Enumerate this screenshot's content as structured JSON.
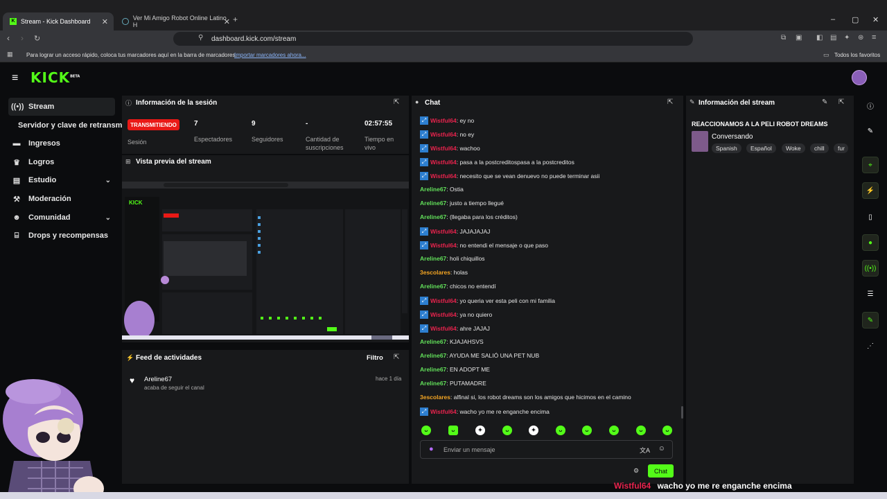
{
  "browser": {
    "tabs": [
      {
        "label": "Stream - Kick Dashboard",
        "active": true
      },
      {
        "label": "Ver Mi Amigo Robot Online Latino H",
        "active": false
      }
    ],
    "url": "dashboard.kick.com/stream",
    "bookmarks_hint": "Para lograr un acceso rápido, coloca tus marcadores aquí en la barra de marcadores.",
    "bookmarks_link": "Importar marcadores ahora...",
    "all_bookmarks": "Todos los favoritos"
  },
  "kick": {
    "logo": "KICK",
    "logo_beta": "BETA"
  },
  "sidebar": {
    "items": [
      {
        "label": "Stream",
        "icon": "broadcast-icon"
      },
      {
        "label": "Servidor y clave de retransmisión",
        "icon": ""
      },
      {
        "label": "Ingresos",
        "icon": "money-icon"
      },
      {
        "label": "Logros",
        "icon": "trophy-icon"
      },
      {
        "label": "Estudio",
        "icon": "studio-icon"
      },
      {
        "label": "Moderación",
        "icon": "hammer-icon"
      },
      {
        "label": "Comunidad",
        "icon": "community-icon"
      },
      {
        "label": "Drops y recompensas",
        "icon": "gift-icon"
      }
    ]
  },
  "session": {
    "title": "Información de la sesión",
    "live_badge": "TRANSMITIENDO",
    "live_label": "Sesión",
    "viewers": "7",
    "viewers_label": "Espectadores",
    "followers": "9",
    "followers_label": "Seguidores",
    "subs": "-",
    "subs_label": "Cantidad de suscripciones",
    "uptime": "02:57:55",
    "uptime_label": "Tiempo en vivo"
  },
  "preview": {
    "title": "Vista previa del stream"
  },
  "activity": {
    "title": "Feed de actividades",
    "filter": "Filtro",
    "items": [
      {
        "user": "Areline67",
        "action": "acaba de seguir el canal",
        "time": "hace 1 día"
      }
    ]
  },
  "chat": {
    "title": "Chat",
    "messages": [
      {
        "user": "Wistful64",
        "color": "red",
        "badge": true,
        "text": ": ey no"
      },
      {
        "user": "Wistful64",
        "color": "red",
        "badge": true,
        "text": ": no ey"
      },
      {
        "user": "Wistful64",
        "color": "red",
        "badge": true,
        "text": ": wachoo"
      },
      {
        "user": "Wistful64",
        "color": "red",
        "badge": true,
        "text": ": pasa a la postcreditospasa a la postcreditos"
      },
      {
        "user": "Wistful64",
        "color": "red",
        "badge": true,
        "text": ": necesito que se vean denuevo no puede terminar asii"
      },
      {
        "user": "Areline67",
        "color": "green",
        "badge": false,
        "text": ": Ostia"
      },
      {
        "user": "Areline67",
        "color": "green",
        "badge": false,
        "text": ": justo a tiempo llegué"
      },
      {
        "user": "Areline67",
        "color": "green",
        "badge": false,
        "text": ": (llegaba para los créditos)"
      },
      {
        "user": "Wistful64",
        "color": "red",
        "badge": true,
        "text": ": JAJAJAJAJ"
      },
      {
        "user": "Wistful64",
        "color": "red",
        "badge": true,
        "text": ": no entendi el mensaje o que paso"
      },
      {
        "user": "Areline67",
        "color": "green",
        "badge": false,
        "text": ": holi chiquillos"
      },
      {
        "user": "3escolares",
        "color": "orange",
        "badge": false,
        "text": ": holas"
      },
      {
        "user": "Areline67",
        "color": "green",
        "badge": false,
        "text": ": chicos no entendí"
      },
      {
        "user": "Wistful64",
        "color": "red",
        "badge": true,
        "text": ": yo queria ver esta peli con mi familia"
      },
      {
        "user": "Wistful64",
        "color": "red",
        "badge": true,
        "text": ": ya no quiero"
      },
      {
        "user": "Wistful64",
        "color": "red",
        "badge": true,
        "text": ": ahre JAJAJ"
      },
      {
        "user": "Areline67",
        "color": "green",
        "badge": false,
        "text": ": KJAJAHSVS"
      },
      {
        "user": "Areline67",
        "color": "green",
        "badge": false,
        "text": ": AYUDA ME SALIÓ UNA PET NUB"
      },
      {
        "user": "Areline67",
        "color": "green",
        "badge": false,
        "text": ": EN ADOPT ME"
      },
      {
        "user": "Areline67",
        "color": "green",
        "badge": false,
        "text": ": PUTAMADRE"
      },
      {
        "user": "3escolares",
        "color": "orange",
        "badge": false,
        "text": ": alfinal si, los robot dreams son los amigos que hicimos en el camino"
      },
      {
        "user": "Wistful64",
        "color": "red",
        "badge": true,
        "text": ": wacho yo me re enganche encima"
      }
    ],
    "input_placeholder": "Enviar un mensaje",
    "send_label": "Chat"
  },
  "stream_info": {
    "title": "Información del stream",
    "stream_title": "REACCIONAMOS A LA PELI ROBOT DREAMS",
    "category": "Conversando",
    "tags": [
      "Spanish",
      "Español",
      "Woke",
      "chill",
      "fur"
    ]
  },
  "overlay": {
    "user": "Wistful64",
    "text": "wacho yo me re enganche encima"
  },
  "colors": {
    "accent": "#53fc18",
    "live": "#e91916",
    "user_red": "#e8234d",
    "user_green": "#62e05a",
    "user_orange": "#f5a623"
  }
}
